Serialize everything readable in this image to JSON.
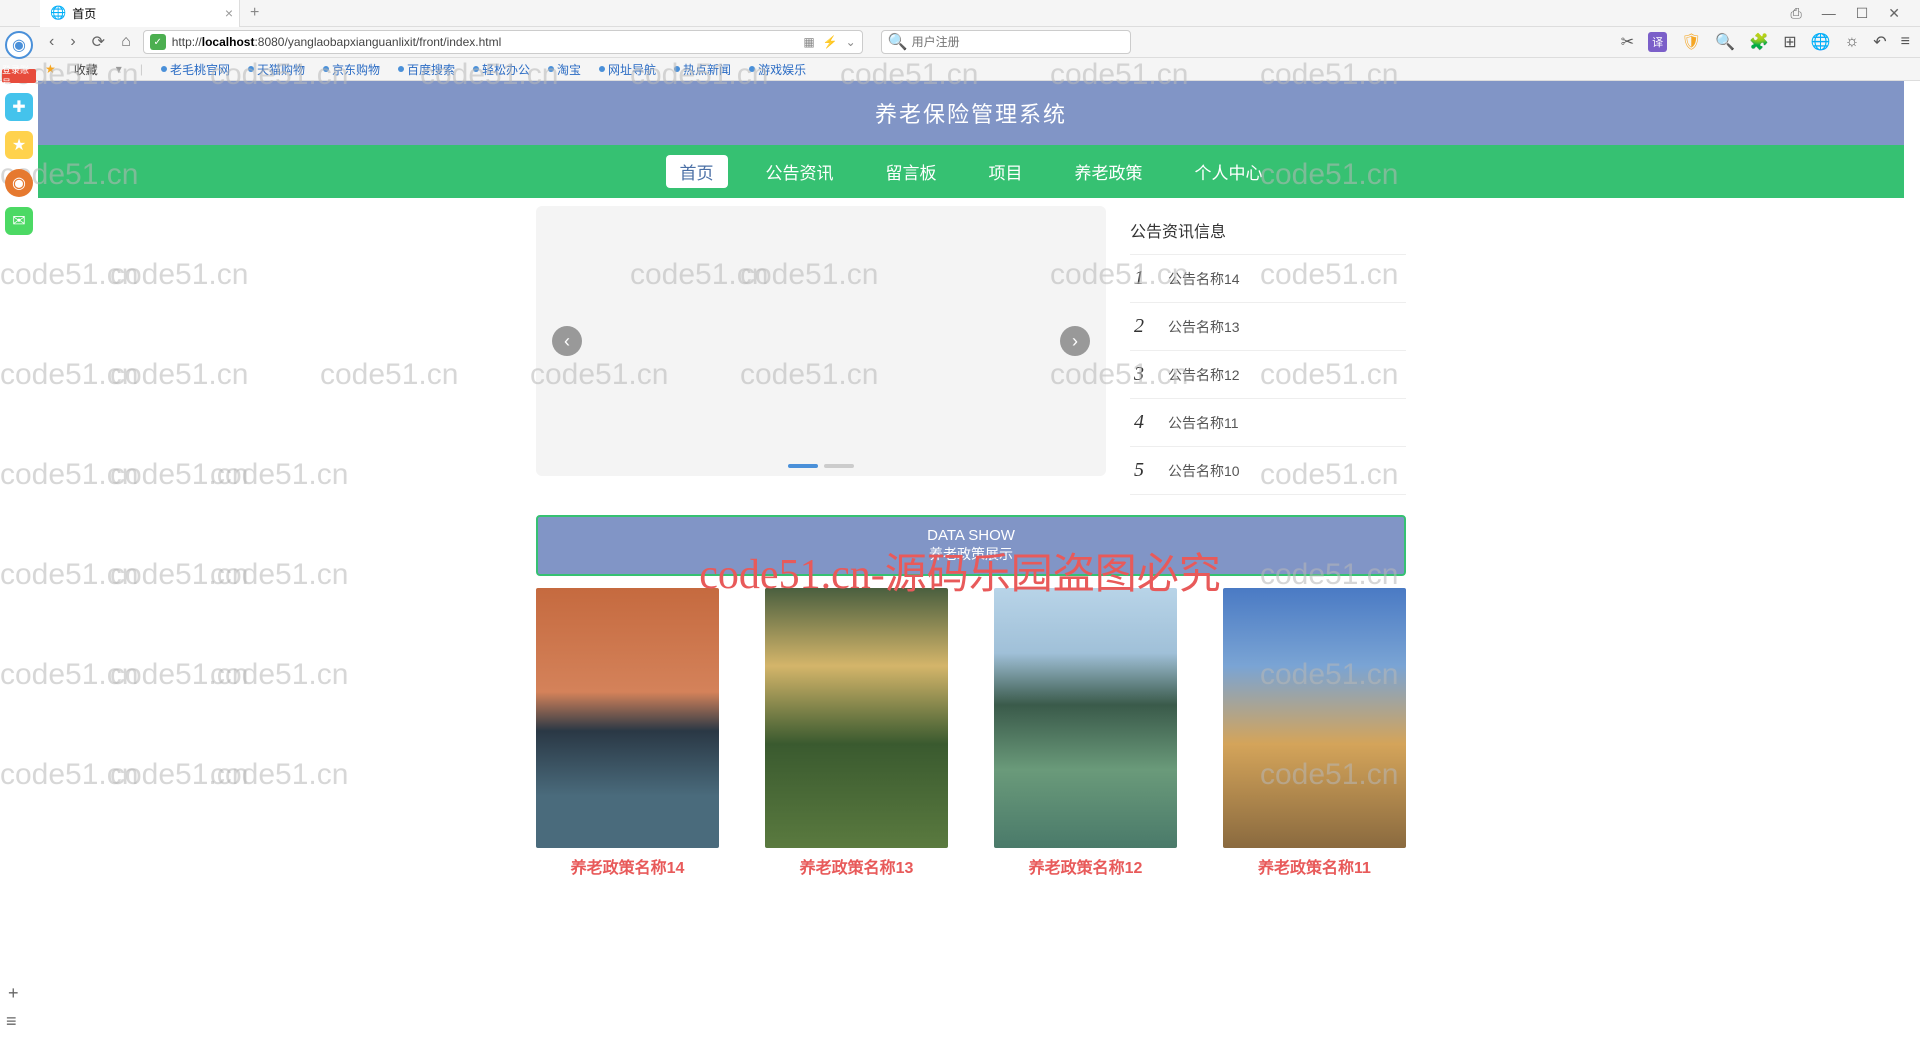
{
  "browser": {
    "tab_title": "首页",
    "url_prefix": "http://",
    "url_host": "localhost",
    "url_path": ":8080/yanglaobapxianguanlixit/front/index.html",
    "search_placeholder": "用户注册"
  },
  "bookmarks": {
    "fav": "收藏",
    "items": [
      "老毛桃官网",
      "天猫购物",
      "京东购物",
      "百度搜索",
      "轻松办公",
      "淘宝",
      "网址导航",
      "热点新闻",
      "游戏娱乐"
    ]
  },
  "site": {
    "title": "养老保险管理系统",
    "nav": [
      "首页",
      "公告资讯",
      "留言板",
      "项目",
      "养老政策",
      "个人中心"
    ]
  },
  "news": {
    "heading": "公告资讯信息",
    "items": [
      {
        "num": "1",
        "label": "公告名称14"
      },
      {
        "num": "2",
        "label": "公告名称13"
      },
      {
        "num": "3",
        "label": "公告名称12"
      },
      {
        "num": "4",
        "label": "公告名称11"
      },
      {
        "num": "5",
        "label": "公告名称10"
      }
    ]
  },
  "datashow": {
    "en": "DATA SHOW",
    "cn": "养老政策展示"
  },
  "cards": [
    {
      "title": "养老政策名称14"
    },
    {
      "title": "养老政策名称13"
    },
    {
      "title": "养老政策名称12"
    },
    {
      "title": "养老政策名称11"
    }
  ],
  "watermark": {
    "text": "code51.cn",
    "center": "code51.cn-源码乐园盗图必究"
  }
}
